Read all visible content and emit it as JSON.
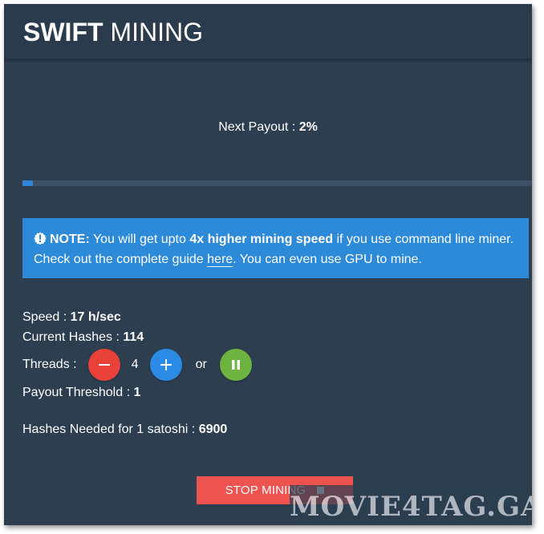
{
  "app": {
    "title_bold": "SWIFT",
    "title_light": "MINING"
  },
  "payout": {
    "label": "Next Payout :",
    "value": "2%",
    "progress_percent": 2
  },
  "note": {
    "icon": "exclamation-circle-icon",
    "heading": "NOTE:",
    "text_1": "You will get upto",
    "highlight": "4x higher mining speed",
    "text_2": "if you use command line miner. Check out the complete guide",
    "link_label": "here",
    "text_3": ". You can even use GPU to mine."
  },
  "stats": {
    "speed_label": "Speed :",
    "speed_value": "17 h/sec",
    "hashes_label": "Current Hashes :",
    "hashes_value": "114",
    "threads_label": "Threads :",
    "threads_value": "4",
    "or_label": "or",
    "threshold_label": "Payout Threshold :",
    "threshold_value": "1",
    "needed_label": "Hashes Needed for 1 satoshi :",
    "needed_value": "6900"
  },
  "controls": {
    "decrease_icon": "minus-icon",
    "increase_icon": "plus-icon",
    "pause_icon": "pause-icon",
    "stop_label": "STOP MINING",
    "stop_icon": "stop-square-icon"
  },
  "watermark": {
    "text": "MOVIE4TAG.GA"
  },
  "colors": {
    "background": "#2c3e50",
    "accent_blue": "#2d8ad9",
    "danger_red": "#e8413a",
    "success_green": "#6cb33f",
    "stop_button": "#ef5350"
  }
}
